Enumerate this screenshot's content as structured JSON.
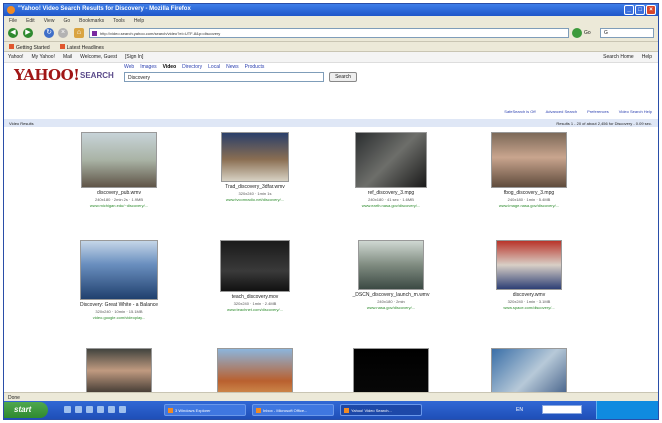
{
  "window": {
    "title": "\"Yahoo! Video Search Results for Discovery - Mozilla Firefox",
    "menu": [
      "File",
      "Edit",
      "View",
      "Go",
      "Bookmarks",
      "Tools",
      "Help"
    ]
  },
  "nav": {
    "url": "http://video.search.yahoo.com/search/video?ei=UTF-8&p=discovery",
    "go_label": "Go",
    "search_value": "G"
  },
  "bookmarks": {
    "items": [
      "Getting Started",
      "Latest Headlines"
    ]
  },
  "yahoo_toolbar": {
    "left": [
      "Yahoo!",
      "My Yahoo!",
      "Mail",
      "Welcome, Guest",
      "[Sign In]"
    ],
    "right": [
      "Search Home",
      "Help"
    ]
  },
  "search": {
    "logo": "YAHOO!",
    "logo_suffix": "SEARCH",
    "tabs": [
      {
        "label": "Web"
      },
      {
        "label": "Images"
      },
      {
        "label": "Video"
      },
      {
        "label": "Directory"
      },
      {
        "label": "Local"
      },
      {
        "label": "News"
      },
      {
        "label": "Products"
      }
    ],
    "query": "Discovery",
    "button_label": "Search",
    "active_tab_index": 2
  },
  "result_links": [
    "SafeSearch is Off",
    "Advanced Search",
    "Preferences",
    "Video Search Help"
  ],
  "subbar": {
    "left": "Video Results",
    "right": "Results 1 - 20 of about 2,456 for Discovery - 0.09 sec."
  },
  "results": [
    {
      "title": "discovery_pub.wmv",
      "meta": "240x180 · 2min 2s · 1.9MB",
      "url": "www.michigan.edu/~discovery/...",
      "scene": "people"
    },
    {
      "title": "Trad_discovery_3dfar.wmv",
      "meta": "320x240 · 1min 1s",
      "url": "www.tvcomradio.net/discovery/...",
      "scene": "studio"
    },
    {
      "title": "ref_discovery_3.mpg",
      "meta": "240x180 · 41 sec · 1.6MB",
      "url": "www.earth.nasa.gov/discovery/...",
      "scene": "space"
    },
    {
      "title": "fbog_discovery_3.mpg",
      "meta": "240x180 · 1min · 5.4MB",
      "url": "www.image.nasa.gov/discovery/...",
      "scene": "portrait"
    },
    {
      "title": "Discovery: Great White - a Balance",
      "meta": "320x240 · 10min · 15.1MB",
      "url": "video.google.com/videoplay...",
      "scene": "ocean"
    },
    {
      "title": "teach_discovery.mov",
      "meta": "320x240 · 1min · 2.4MB",
      "url": "www.teachnet.com/discovery/...",
      "scene": "dark"
    },
    {
      "title": "_DSCN_discovery_launch_m.wmv",
      "meta": "240x180 · 2min",
      "url": "www.nasa.gov/discovery/...",
      "scene": "launch"
    },
    {
      "title": "discovery.wmv",
      "meta": "320x240 · 1min · 3.1MB",
      "url": "www.space.com/discovery/...",
      "scene": "anchor"
    },
    {
      "title": "",
      "meta": "",
      "url": "",
      "scene": "face"
    },
    {
      "title": "",
      "meta": "",
      "url": "",
      "scene": "robot"
    },
    {
      "title": "",
      "meta": "",
      "url": "",
      "scene": "black"
    },
    {
      "title": "",
      "meta": "",
      "url": "",
      "scene": "crowd"
    }
  ],
  "status": {
    "text": "Done"
  },
  "taskbar": {
    "start_label": "start",
    "items": [
      "3 Windows Explorer",
      "Inbox - Microsoft Office...",
      "Yahoo! Video Search..."
    ],
    "language": "EN",
    "clock": ""
  }
}
